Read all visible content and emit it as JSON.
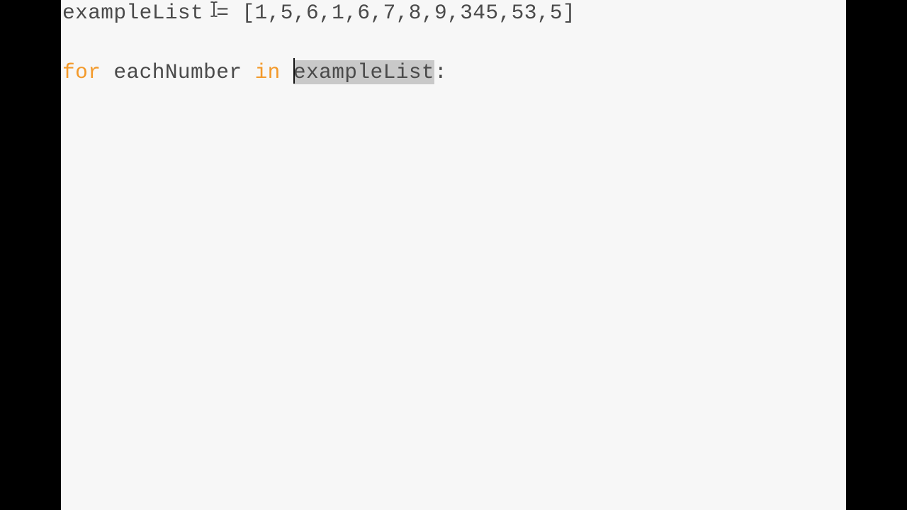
{
  "editor": {
    "lines": {
      "line1": {
        "identifier": "exampleList",
        "operator": " = ",
        "value": "[1,5,6,1,6,7,8,9,345,53,5]"
      },
      "line3": {
        "kw_for": "for",
        "loop_var": " eachNumber ",
        "kw_in": "in",
        "space": " ",
        "selected_text": "exampleList",
        "colon": ":"
      }
    },
    "colors": {
      "background": "#f7f7f7",
      "text": "#4a4a4a",
      "keyword": "#f39a2b",
      "selection": "#c9c9c9",
      "frame": "#000000"
    },
    "cursor_icon": "text-ibeam-icon"
  }
}
